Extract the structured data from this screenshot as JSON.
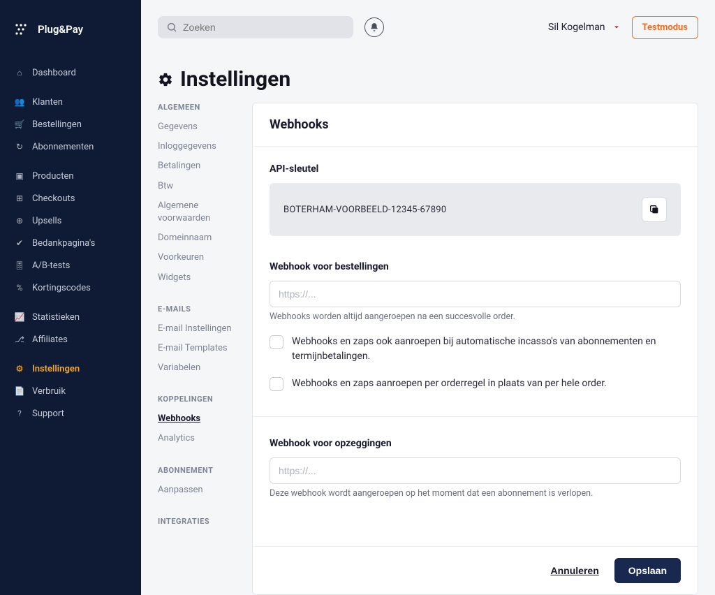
{
  "brand": {
    "name": "Plug&Pay"
  },
  "search": {
    "placeholder": "Zoeken"
  },
  "user": {
    "name": "Sil Kogelman"
  },
  "testmode_label": "Testmodus",
  "nav": {
    "items": [
      {
        "label": "Dashboard",
        "icon": "home"
      },
      {
        "label": "Klanten",
        "icon": "users"
      },
      {
        "label": "Bestellingen",
        "icon": "cart"
      },
      {
        "label": "Abonnementen",
        "icon": "refresh"
      },
      {
        "label": "Producten",
        "icon": "package"
      },
      {
        "label": "Checkouts",
        "icon": "grid"
      },
      {
        "label": "Upsells",
        "icon": "plus-circle"
      },
      {
        "label": "Bedankpagina's",
        "icon": "check"
      },
      {
        "label": "A/B-tests",
        "icon": "gauge"
      },
      {
        "label": "Kortingscodes",
        "icon": "percent"
      },
      {
        "label": "Statistieken",
        "icon": "chart"
      },
      {
        "label": "Affiliates",
        "icon": "share"
      },
      {
        "label": "Instellingen",
        "icon": "gear",
        "active": true
      },
      {
        "label": "Verbruik",
        "icon": "file"
      },
      {
        "label": "Support",
        "icon": "help"
      }
    ],
    "groups": [
      [
        0
      ],
      [
        1,
        2,
        3
      ],
      [
        4,
        5,
        6,
        7,
        8,
        9
      ],
      [
        10,
        11
      ],
      [
        12,
        13,
        14
      ]
    ]
  },
  "page": {
    "title": "Instellingen"
  },
  "subnav": {
    "groups": [
      {
        "label": "ALGEMEEN",
        "items": [
          "Gegevens",
          "Inloggegevens",
          "Betalingen",
          "Btw",
          "Algemene voorwaarden",
          "Domeinnaam",
          "Voorkeuren",
          "Widgets"
        ]
      },
      {
        "label": "E-MAILS",
        "items": [
          "E-mail Instellingen",
          "E-mail Templates",
          "Variabelen"
        ]
      },
      {
        "label": "KOPPELINGEN",
        "items": [
          "Webhooks",
          "Analytics"
        ],
        "activeIndex": 0
      },
      {
        "label": "ABONNEMENT",
        "items": [
          "Aanpassen"
        ]
      },
      {
        "label": "INTEGRATIES",
        "items": []
      }
    ]
  },
  "panel": {
    "title": "Webhooks",
    "api_key_label": "API-sleutel",
    "api_key_value": "BOTERHAM-VOORBEELD-12345-67890",
    "orders": {
      "label": "Webhook voor bestellingen",
      "placeholder": "https://...",
      "help": "Webhooks worden altijd aangeroepen na een succesvolle order.",
      "check1": "Webhooks en zaps ook aanroepen bij automatische incasso's van abonnementen en termijnbetalingen.",
      "check2": "Webhooks en zaps aanroepen per orderregel in plaats van per hele order."
    },
    "cancel": {
      "label": "Webhook voor opzeggingen",
      "placeholder": "https://...",
      "help": "Deze webhook wordt aangeroepen op het moment dat een abonnement is verlopen."
    },
    "buttons": {
      "cancel": "Annuleren",
      "save": "Opslaan"
    }
  }
}
